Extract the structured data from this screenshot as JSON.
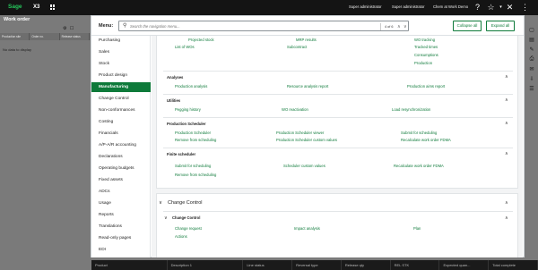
{
  "topbar": {
    "logo": "Sage",
    "product": "X3",
    "user1": "Super administrator",
    "user2": "Super administrator",
    "site": "Chem at Work Demo"
  },
  "background": {
    "page_title": "Work order",
    "table_headers": [
      "Production site",
      "Order no.",
      "Release status"
    ],
    "no_data": "No data to display",
    "bottom_columns": [
      "Product",
      "Description 1",
      "Line status",
      "Reversal type",
      "Release qty",
      "REL STK",
      "Expected quan...",
      "Total complete"
    ]
  },
  "nav": {
    "title": "Menu:",
    "search_placeholder": "Search the navigation menu...",
    "pager_count": "4 of 6",
    "collapse_label": "Collapse all",
    "expand_label": "Expand all",
    "sidebar": [
      {
        "label": "Purchasing",
        "active": false
      },
      {
        "label": "Sales",
        "active": false
      },
      {
        "label": "Stock",
        "active": false
      },
      {
        "label": "Product design",
        "active": false
      },
      {
        "label": "Manufacturing",
        "active": true
      },
      {
        "label": "Change Control",
        "active": false
      },
      {
        "label": "Non-conformances",
        "active": false
      },
      {
        "label": "Costing",
        "active": false
      },
      {
        "label": "Financials",
        "active": false
      },
      {
        "label": "A/P-A/R accounting",
        "active": false
      },
      {
        "label": "Declarations",
        "active": false
      },
      {
        "label": "Operating budgets",
        "active": false
      },
      {
        "label": "Fixed assets",
        "active": false
      },
      {
        "label": "ADCs",
        "active": false
      },
      {
        "label": "Usage",
        "active": false
      },
      {
        "label": "Reports",
        "active": false
      },
      {
        "label": "Translations",
        "active": false
      },
      {
        "label": "Read-only pages",
        "active": false
      },
      {
        "label": "EDI",
        "active": false
      }
    ],
    "top_card": {
      "links": [
        "Projected stock",
        "MRP results",
        "WO tracking",
        "List of WOs",
        "Subcontract",
        "Tracked times",
        "Consumptions",
        "Production"
      ],
      "sections": [
        {
          "title": "Analyses",
          "links": [
            "Production analysis",
            "Resource analysis report",
            "Production aims report"
          ]
        },
        {
          "title": "Utilities",
          "links": [
            "Pegging history",
            "WO reactivation",
            "Load resynchronization"
          ]
        },
        {
          "title": "Production Scheduler",
          "links": [
            "Production Scheduler",
            "Production Scheduler viewer",
            "Submit for scheduling",
            "Remove from scheduling",
            "Production Scheduler custom values",
            "Recalculate work order FDMA"
          ]
        },
        {
          "title": "Finite scheduler",
          "links": [
            "Submit for scheduling",
            "Scheduler custom values",
            "Recalculate work order FDMA",
            "Remove from scheduling"
          ]
        }
      ]
    },
    "change_control": {
      "title": "Change Control",
      "section_title": "Change Control",
      "links": [
        "Change request",
        "Impact analysis",
        "Plan",
        "Actions"
      ]
    }
  }
}
